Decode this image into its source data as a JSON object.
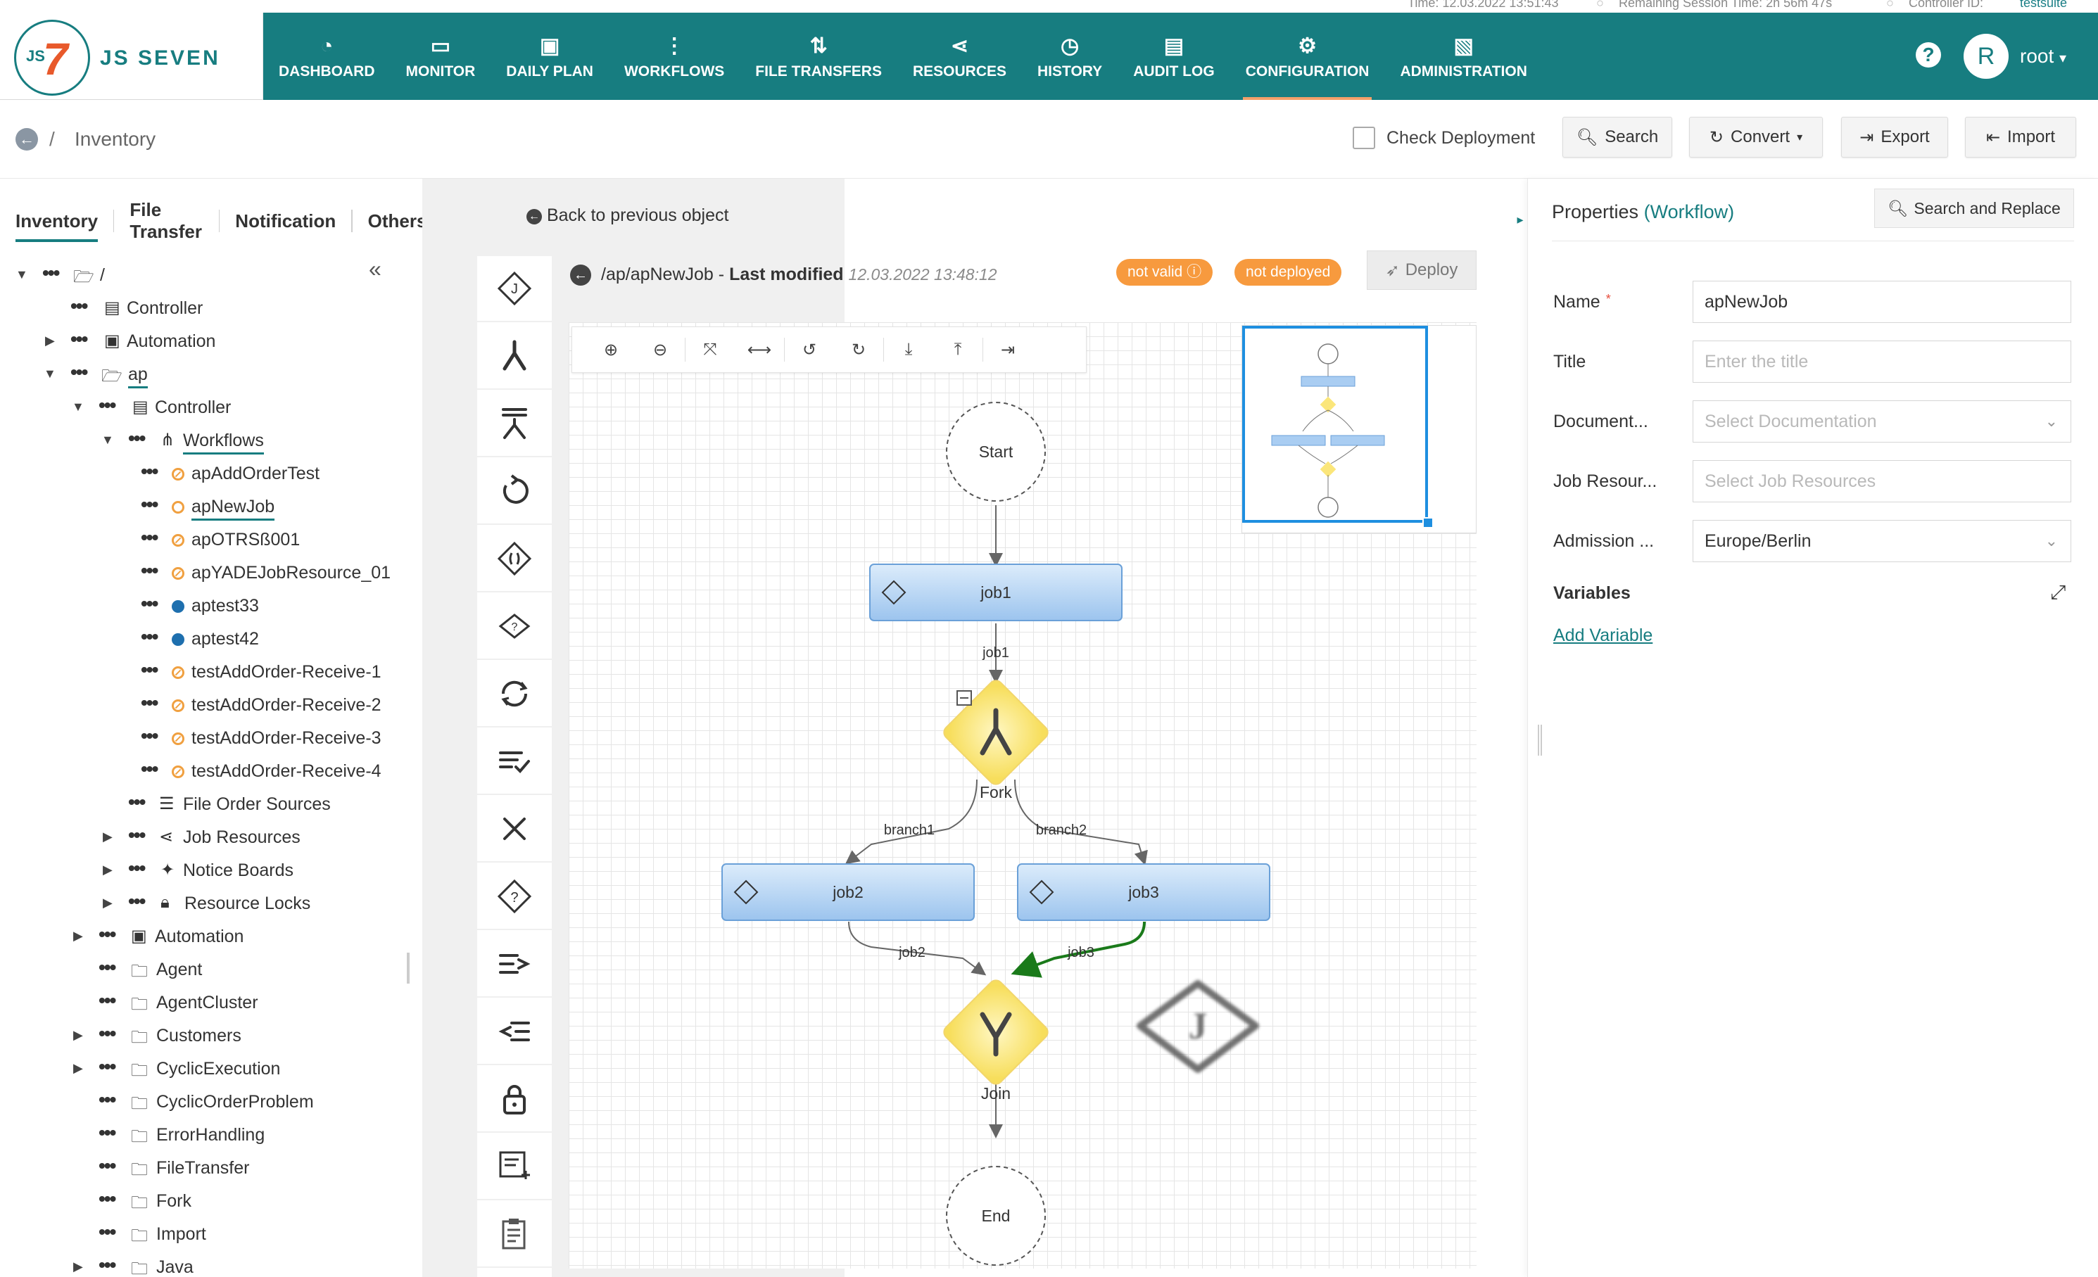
{
  "status_bar": {
    "time": "Time: 12.03.2022 13:51:43",
    "session": "Remaining Session Time: 2h 56m 47s",
    "controller_label": "Controller ID:",
    "controller_id": "testsuite"
  },
  "logo": {
    "text": "JS SEVEN"
  },
  "nav": [
    {
      "label": "DASHBOARD",
      "icon": "dashboard-icon"
    },
    {
      "label": "MONITOR",
      "icon": "monitor-icon"
    },
    {
      "label": "DAILY PLAN",
      "icon": "calendar-icon"
    },
    {
      "label": "WORKFLOWS",
      "icon": "workflow-icon"
    },
    {
      "label": "FILE TRANSFERS",
      "icon": "transfer-icon"
    },
    {
      "label": "RESOURCES",
      "icon": "share-icon"
    },
    {
      "label": "HISTORY",
      "icon": "history-icon"
    },
    {
      "label": "AUDIT LOG",
      "icon": "audit-icon"
    },
    {
      "label": "CONFIGURATION",
      "icon": "gear-icon",
      "active": true
    },
    {
      "label": "ADMINISTRATION",
      "icon": "admin-icon"
    }
  ],
  "user": {
    "initial": "R",
    "name": "root"
  },
  "breadcrumb": {
    "separator": "/",
    "title": "Inventory"
  },
  "toolbar": {
    "check_deployment": "Check Deployment",
    "search": "Search",
    "convert": "Convert",
    "export": "Export",
    "import": "Import"
  },
  "left_tabs": [
    "Inventory",
    "File Transfer",
    "Notification",
    "Others"
  ],
  "back_to_previous": "Back to previous object",
  "tree": {
    "root": "/",
    "controller": "Controller",
    "automation": "Automation",
    "ap": "ap",
    "ap_controller": "Controller",
    "workflows": "Workflows",
    "workflow_items": [
      "apAddOrderTest",
      "apNewJob",
      "apOTRSß001",
      "apYADEJobResource_01",
      "aptest33",
      "aptest42",
      "testAddOrder-Receive-1",
      "testAddOrder-Receive-2",
      "testAddOrder-Receive-3",
      "testAddOrder-Receive-4"
    ],
    "file_order_sources": "File Order Sources",
    "job_resources": "Job Resources",
    "notice_boards": "Notice Boards",
    "resource_locks": "Resource Locks",
    "ap_automation": "Automation",
    "folders": [
      "Agent",
      "AgentCluster",
      "Customers",
      "CyclicExecution",
      "CyclicOrderProblem",
      "ErrorHandling",
      "FileTransfer",
      "Fork",
      "Import",
      "Java"
    ]
  },
  "editor": {
    "path": "/ap/apNewJob",
    "sep": "-",
    "last_modified_label": "Last modified",
    "last_modified": "12.03.2022 13:48:12",
    "badge_not_valid": "not valid",
    "badge_not_deployed": "not deployed",
    "deploy": "Deploy"
  },
  "workflow": {
    "start": "Start",
    "end": "End",
    "fork": "Fork",
    "join": "Join",
    "jobs": [
      "job1",
      "job2",
      "job3"
    ],
    "edge_labels": [
      "job1",
      "branch1",
      "branch2",
      "job2",
      "job3"
    ]
  },
  "properties": {
    "title": "Properties",
    "type": "(Workflow)",
    "search_replace": "Search and Replace",
    "fields": {
      "name_label": "Name",
      "name_value": "apNewJob",
      "title_label": "Title",
      "title_placeholder": "Enter the title",
      "doc_label": "Document...",
      "doc_placeholder": "Select Documentation",
      "jobres_label": "Job Resour...",
      "jobres_placeholder": "Select Job Resources",
      "admission_label": "Admission ...",
      "admission_value": "Europe/Berlin"
    },
    "variables_label": "Variables",
    "add_variable": "Add Variable"
  },
  "colors": {
    "brand": "#177d80",
    "accent": "#f79a3e",
    "job_fill": "#a9cdf2",
    "instruction_fill": "#fbe67a",
    "highlight_edge": "#1a7a1a"
  }
}
